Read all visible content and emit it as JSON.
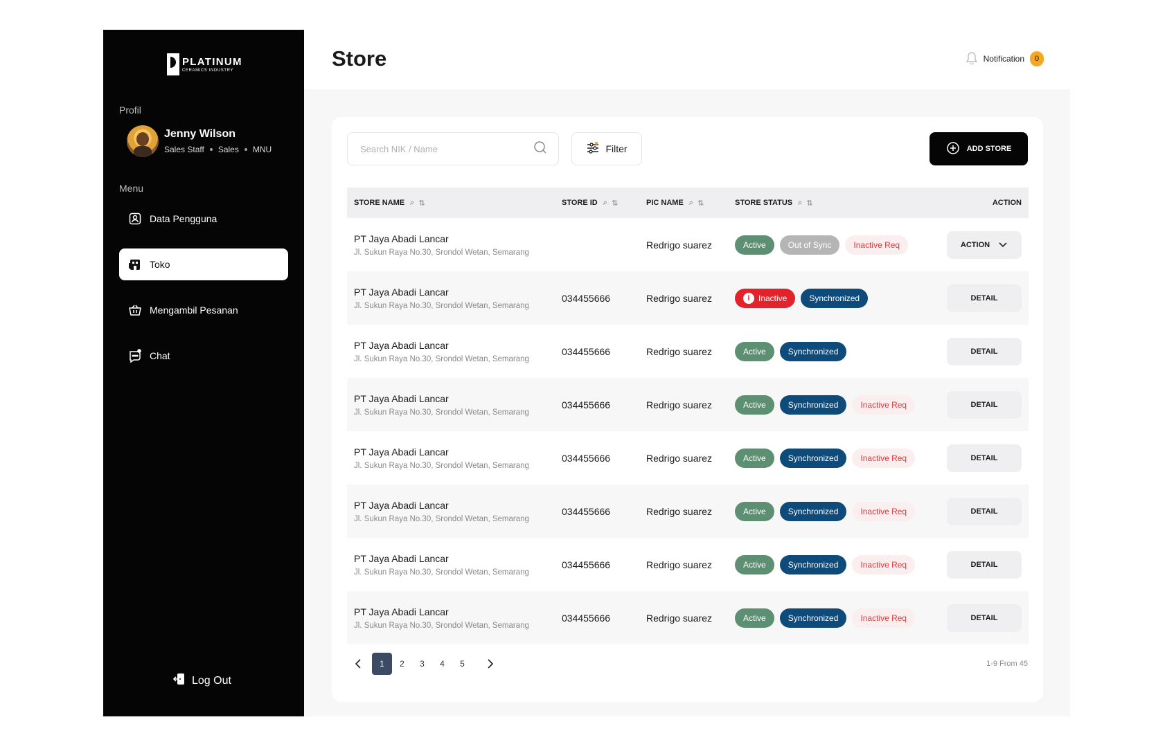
{
  "brand": {
    "name": "PLATINUM",
    "sub": "CERAMICS INDUSTRY"
  },
  "sidebar": {
    "profile_label": "Profil",
    "user": {
      "name": "Jenny Wilson",
      "role": "Sales Staff",
      "division": "Sales",
      "branch": "MNU"
    },
    "menu_label": "Menu",
    "items": [
      {
        "label": "Data Pengguna",
        "icon": "user-badge-icon",
        "active": false
      },
      {
        "label": "Toko",
        "icon": "store-icon",
        "active": true
      },
      {
        "label": "Mengambil Pesanan",
        "icon": "basket-icon",
        "active": false
      },
      {
        "label": "Chat",
        "icon": "chat-icon",
        "active": false
      }
    ],
    "logout_label": "Log Out"
  },
  "header": {
    "title": "Store",
    "notification_label": "Notification",
    "notification_count": "0"
  },
  "toolbar": {
    "search_placeholder": "Search NIK / Name",
    "filter_label": "Filter",
    "add_label": "ADD STORE"
  },
  "table": {
    "columns": [
      "STORE NAME",
      "STORE ID",
      "PIC NAME",
      "STORE STATUS",
      "ACTION"
    ],
    "rows": [
      {
        "name": "PT Jaya Abadi Lancar",
        "address": "Jl. Sukun Raya No.30, Srondol Wetan, Semarang",
        "id": "",
        "pic": "Redrigo suarez",
        "status": [
          "Active",
          "Out of Sync",
          "Inactive Req"
        ],
        "action": "ACTION"
      },
      {
        "name": "PT Jaya Abadi Lancar",
        "address": "Jl. Sukun Raya No.30, Srondol Wetan, Semarang",
        "id": "034455666",
        "pic": "Redrigo suarez",
        "status": [
          "Inactive",
          "Synchronized"
        ],
        "action": "DETAIL"
      },
      {
        "name": "PT Jaya Abadi Lancar",
        "address": "Jl. Sukun Raya No.30, Srondol Wetan, Semarang",
        "id": "034455666",
        "pic": "Redrigo suarez",
        "status": [
          "Active",
          "Synchronized"
        ],
        "action": "DETAIL"
      },
      {
        "name": "PT Jaya Abadi Lancar",
        "address": "Jl. Sukun Raya No.30, Srondol Wetan, Semarang",
        "id": "034455666",
        "pic": "Redrigo suarez",
        "status": [
          "Active",
          "Synchronized",
          "Inactive Req"
        ],
        "action": "DETAIL"
      },
      {
        "name": "PT Jaya Abadi Lancar",
        "address": "Jl. Sukun Raya No.30, Srondol Wetan, Semarang",
        "id": "034455666",
        "pic": "Redrigo suarez",
        "status": [
          "Active",
          "Synchronized",
          "Inactive Req"
        ],
        "action": "DETAIL"
      },
      {
        "name": "PT Jaya Abadi Lancar",
        "address": "Jl. Sukun Raya No.30, Srondol Wetan, Semarang",
        "id": "034455666",
        "pic": "Redrigo suarez",
        "status": [
          "Active",
          "Synchronized",
          "Inactive Req"
        ],
        "action": "DETAIL"
      },
      {
        "name": "PT Jaya Abadi Lancar",
        "address": "Jl. Sukun Raya No.30, Srondol Wetan, Semarang",
        "id": "034455666",
        "pic": "Redrigo suarez",
        "status": [
          "Active",
          "Synchronized",
          "Inactive Req"
        ],
        "action": "DETAIL"
      },
      {
        "name": "PT Jaya Abadi Lancar",
        "address": "Jl. Sukun Raya No.30, Srondol Wetan, Semarang",
        "id": "034455666",
        "pic": "Redrigo suarez",
        "status": [
          "Active",
          "Synchronized",
          "Inactive Req"
        ],
        "action": "DETAIL"
      }
    ]
  },
  "pagination": {
    "pages": [
      "1",
      "2",
      "3",
      "4",
      "5"
    ],
    "current": "1",
    "range_text": "1-9 From 45"
  },
  "colors": {
    "sidebar_bg": "#050505",
    "active_chip": "#5d8f73",
    "sync_chip": "#0e4a7a",
    "inactive_chip": "#e3232b",
    "notif_badge": "#f5a623"
  }
}
